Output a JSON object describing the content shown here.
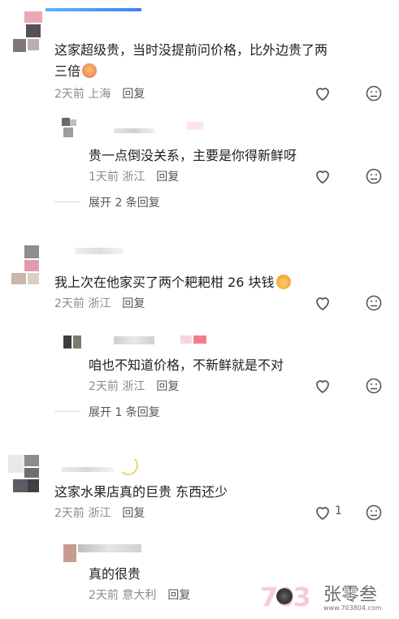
{
  "comments": [
    {
      "text": "这家超级贵，当时没提前问价格，比外边贵了两",
      "text_line2": "三倍",
      "emoji": "crying-face-emoji",
      "time": "2天前",
      "location": "上海",
      "reply_label": "回复",
      "replies": [
        {
          "text": "贵一点倒没关系，主要是你得新鲜呀",
          "time": "1天前",
          "location": "浙江",
          "reply_label": "回复"
        }
      ],
      "expand_label": "展开 2 条回复"
    },
    {
      "text": "我上次在他家买了两个耙耙柑 26 块钱",
      "emoji": "tangerine-face-emoji",
      "time": "2天前",
      "location": "浙江",
      "reply_label": "回复",
      "replies": [
        {
          "text": "咱也不知道价格，不新鲜就是不对",
          "time": "2天前",
          "location": "浙江",
          "reply_label": "回复"
        }
      ],
      "expand_label": "展开 1 条回复"
    },
    {
      "text": "这家水果店真的巨贵 东西还少",
      "time": "2天前",
      "location": "浙江",
      "reply_label": "回复",
      "like_count": "1",
      "replies": [
        {
          "text": "真的很贵",
          "time": "2天前",
          "location": "意大利",
          "reply_label": "回复"
        }
      ]
    }
  ],
  "watermark": {
    "brand": "张零叁",
    "url": "www.703804.com",
    "logo_text": "703"
  },
  "colors": {
    "text": "#1f1f1f",
    "meta": "#8a8a8a",
    "icon": "#555555"
  }
}
